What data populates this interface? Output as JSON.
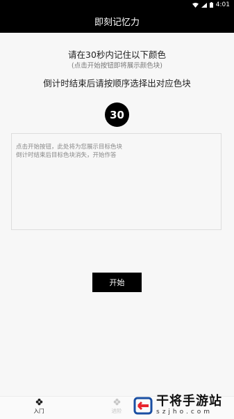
{
  "status_bar": {
    "time": "4:01"
  },
  "header": {
    "title": "即刻记忆力"
  },
  "instructions": {
    "line1": "请在30秒内记住以下颜色",
    "line2": "(点击开始按钮即将展示颜色块)",
    "line3": "倒计时结束后请按顺序选择出对应色块"
  },
  "timer": {
    "value": "30"
  },
  "display_area": {
    "hint_line1": "点击开始按钮，此处将为您展示目标色块",
    "hint_line2": "倒计时结束后目标色块消失，开始作答"
  },
  "start_button": {
    "label": "开始"
  },
  "bottom_nav": {
    "items": [
      {
        "label": "入门",
        "icon": "flower-icon"
      },
      {
        "label": "进阶",
        "icon": "flower-icon"
      }
    ]
  },
  "watermark": {
    "main": "干将手游站",
    "sub": "szjho.com"
  },
  "colors": {
    "bar_bg": "#000000",
    "page_bg": "#f7f7f7",
    "logo_red": "#e8242c",
    "logo_blue": "#1a4fa3"
  }
}
